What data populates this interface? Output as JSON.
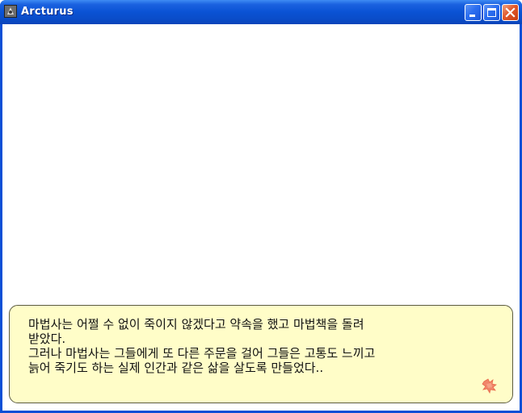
{
  "window": {
    "title": "Arcturus",
    "icon": "app-icon",
    "buttons": {
      "minimize": "minimize-icon",
      "maximize": "maximize-icon",
      "close": "close-icon"
    }
  },
  "dialog": {
    "lines": [
      "마법사는 어쩔 수 없이 죽이지 않겠다고 약속을 했고 마법책을 돌려",
      "받았다.",
      "그러나 마법사는 그들에게 또 다른 주문을 걸어 그들은 고통도 느끼고",
      "늙어 죽기도 하는 실제 인간과 같은 삶을 살도록 만들었다.."
    ],
    "next_indicator": "next-arrow-icon"
  },
  "colors": {
    "titlebar": "#0a52d4",
    "dialog_bg": "#fffdc8",
    "next_icon": "#f0866a"
  }
}
